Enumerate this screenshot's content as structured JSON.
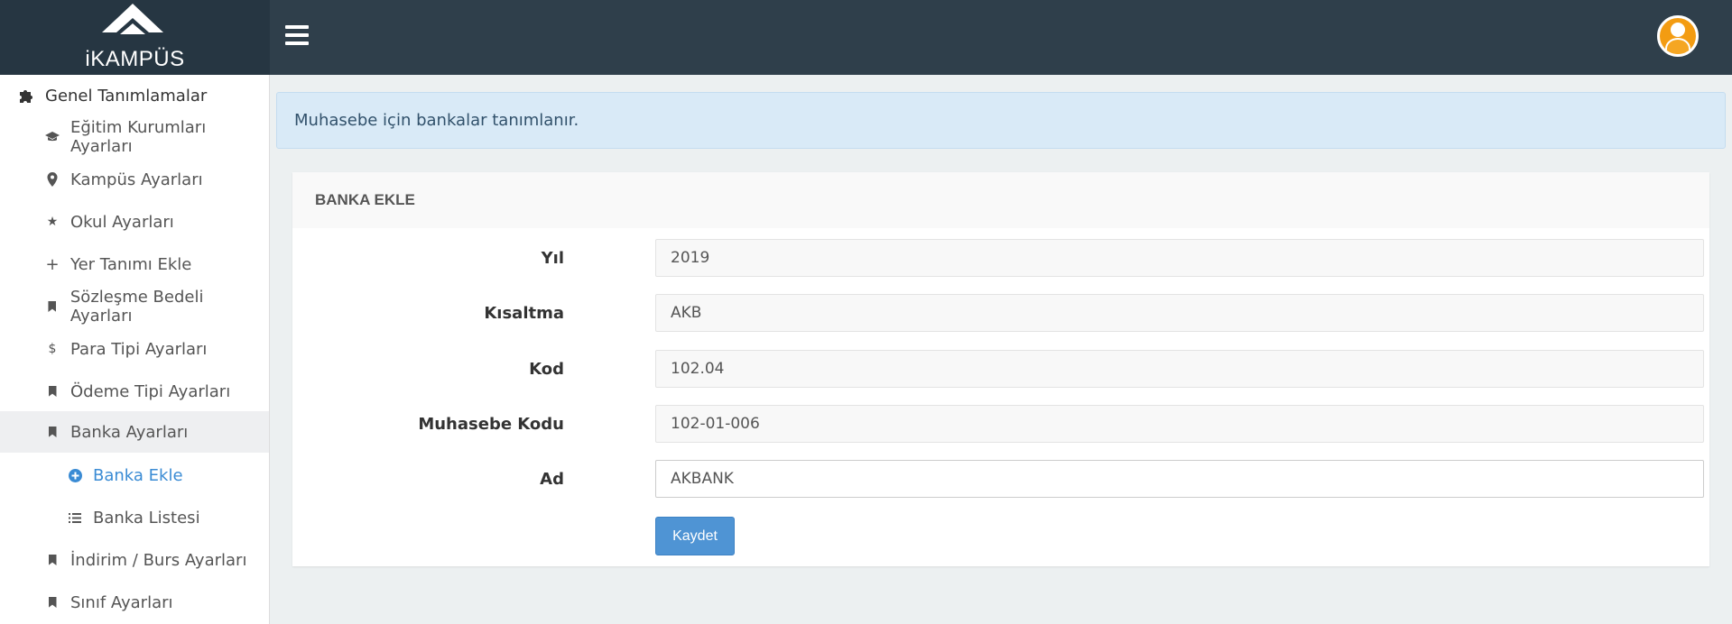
{
  "brand": {
    "logo_text": "iKAMPÜS"
  },
  "header": {
    "menu_icon": "hamburger-icon",
    "avatar_icon": "user-avatar-icon"
  },
  "sidebar": {
    "items": [
      {
        "label": "Genel Tanımlamalar",
        "icon": "puzzle-icon"
      },
      {
        "label": "Eğitim Kurumları Ayarları",
        "icon": "graduation-cap-icon"
      },
      {
        "label": "Kampüs Ayarları",
        "icon": "map-pin-icon"
      },
      {
        "label": "Okul Ayarları",
        "icon": "star-icon"
      },
      {
        "label": "Yer Tanımı Ekle",
        "icon": "plus-icon"
      },
      {
        "label": "Sözleşme Bedeli Ayarları",
        "icon": "bookmark-icon"
      },
      {
        "label": "Para Tipi Ayarları",
        "icon": "dollar-icon"
      },
      {
        "label": "Ödeme Tipi Ayarları",
        "icon": "bookmark-icon"
      },
      {
        "label": "Banka Ayarları",
        "icon": "bookmark-icon"
      },
      {
        "label": "Banka Ekle",
        "icon": "plus-circle-icon"
      },
      {
        "label": "Banka Listesi",
        "icon": "list-icon"
      },
      {
        "label": "İndirim / Burs Ayarları",
        "icon": "bookmark-icon"
      },
      {
        "label": "Sınıf Ayarları",
        "icon": "bookmark-icon"
      }
    ]
  },
  "alert": {
    "text": "Muhasebe için bankalar tanımlanır."
  },
  "form": {
    "title": "BANKA EKLE",
    "fields": [
      {
        "label": "Yıl",
        "value": "2019"
      },
      {
        "label": "Kısaltma",
        "value": "AKB"
      },
      {
        "label": "Kod",
        "value": "102.04"
      },
      {
        "label": "Muhasebe Kodu",
        "value": "102-01-006"
      },
      {
        "label": "Ad",
        "value": "AKBANK"
      }
    ],
    "save_label": "Kaydet"
  },
  "colors": {
    "topbar": "#2f3f4b",
    "accent": "#3a8bd4",
    "button": "#4f94d4",
    "avatar": "#f39c12"
  }
}
